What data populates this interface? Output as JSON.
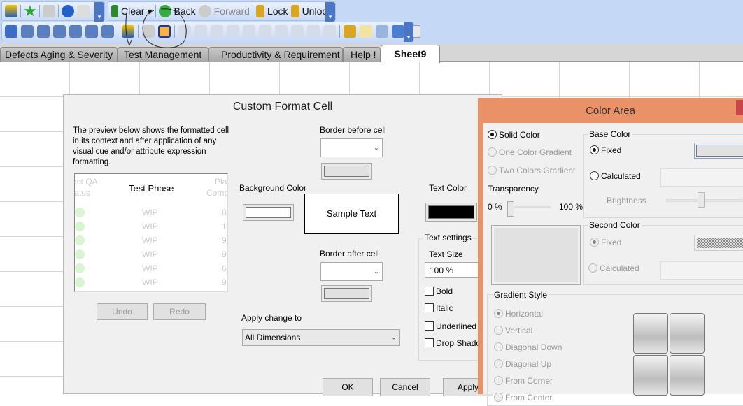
{
  "toolbar": {
    "row1": {
      "icons": [
        "chart-lightning-icon",
        "star-icon",
        "edit-icon",
        "help-icon",
        "pointer-help-icon"
      ],
      "clear": "Clear",
      "back": "Back",
      "forward": "Forward",
      "lock": "Lock",
      "unlock": "Unlock"
    },
    "row2": {
      "icons": [
        "text-format-icon",
        "list-icon",
        "view-icon",
        "favorite-icon",
        "zoom-icon",
        "layout-icon",
        "smiley-icon",
        "chart-lightning-icon",
        "check-icon",
        "format-cell-icon",
        "align-left-icon",
        "space-horizontal-icon",
        "align-right-icon",
        "align-bottom-icon",
        "center-icon",
        "align-top-icon",
        "space-vertical-icon",
        "equal-width-icon",
        "arrange-icon",
        "align-stack-icon",
        "user-icon",
        "document-edit-icon",
        "form-edit-icon",
        "hierarchy-icon",
        "web-page-icon"
      ]
    }
  },
  "tabs": [
    "Defects Aging & Severity",
    "Test Management",
    "Productivity & Requirement",
    "Help !",
    "Sheet9"
  ],
  "custom_format": {
    "title": "Custom Format Cell",
    "description": "The preview below shows the formatted cell in its context and after application of any visual cue and/or attribute expression formatting.",
    "preview": {
      "left_header_1": "ect QA",
      "left_header_2": "tatus",
      "center_header": "Test Phase",
      "right_header_1": "Pla",
      "right_header_2": "Comp",
      "rows": [
        {
          "phase": "WIP",
          "value": "8"
        },
        {
          "phase": "WIP",
          "value": "1"
        },
        {
          "phase": "WIP",
          "value": "9"
        },
        {
          "phase": "WIP",
          "value": "9"
        },
        {
          "phase": "WIP",
          "value": "6"
        },
        {
          "phase": "WIP",
          "value": "9"
        }
      ]
    },
    "undo": "Undo",
    "redo": "Redo",
    "border_before": "Border before cell",
    "border_after": "Border after cell",
    "background_color": "Background Color",
    "text_color": "Text Color",
    "sample_text": "Sample Text",
    "text_settings": "Text settings",
    "text_size_label": "Text Size",
    "text_size": "100 %",
    "bold": "Bold",
    "italic": "Italic",
    "underlined": "Underlined",
    "drop_shadow": "Drop Shadow",
    "apply_change_to": "Apply change to",
    "apply_change_value": "All Dimensions",
    "ok": "OK",
    "cancel": "Cancel",
    "apply": "Apply",
    "colors": {
      "background": "#ffffff",
      "text": "#000000"
    }
  },
  "color_area": {
    "title": "Color Area",
    "solid": "Solid Color",
    "one_gradient": "One Color Gradient",
    "two_gradient": "Two Colors Gradient",
    "transparency": "Transparency",
    "transparency_min": "0 %",
    "transparency_max": "100 %",
    "transparency_value": 0,
    "base_color": "Base Color",
    "fixed": "Fixed",
    "calculated": "Calculated",
    "brightness": "Brightness",
    "brightness_value": 0.5,
    "second_color": "Second Color",
    "gradient_style": "Gradient Style",
    "styles": [
      "Horizontal",
      "Vertical",
      "Diagonal Down",
      "Diagonal Up",
      "From Corner",
      "From Center"
    ],
    "selected_fill": "Solid Color",
    "colors": {
      "base": "#e1e1e1",
      "title_bar": "#ea9167"
    }
  }
}
